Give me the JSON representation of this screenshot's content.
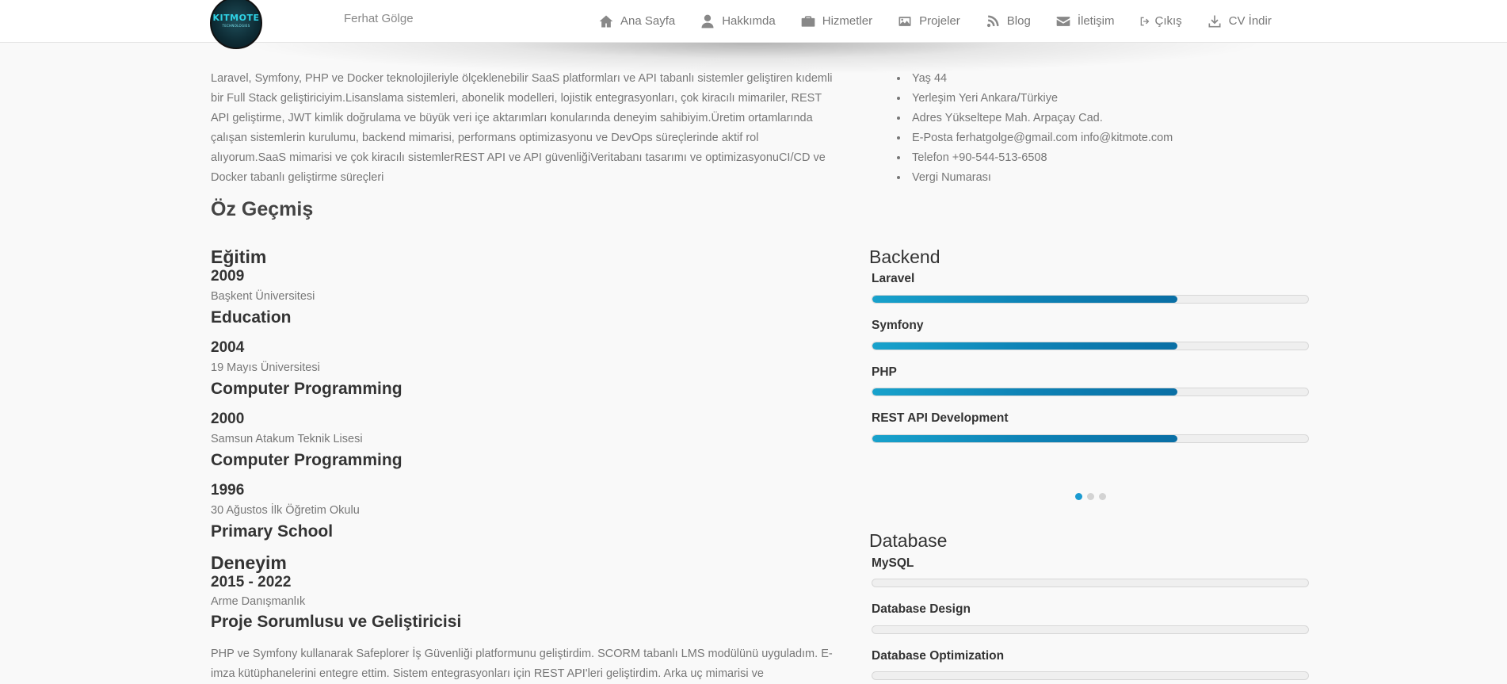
{
  "header": {
    "logo_text": "KITMOTE",
    "logo_subtext": "TECHNOLOGIES",
    "brand_name": "Ferhat Gölge",
    "nav": [
      {
        "label": "Ana Sayfa",
        "icon": "home-icon"
      },
      {
        "label": "Hakkımda",
        "icon": "user-icon"
      },
      {
        "label": "Hizmetler",
        "icon": "briefcase-icon"
      },
      {
        "label": "Projeler",
        "icon": "images-icon"
      },
      {
        "label": "Blog",
        "icon": "blog-icon"
      },
      {
        "label": "İletişim",
        "icon": "envelope-icon"
      },
      {
        "label": "Çıkış",
        "icon": "sign-out-icon"
      },
      {
        "label": "CV İndir",
        "icon": "download-icon"
      }
    ]
  },
  "intro": {
    "text": "Laravel, Symfony, PHP ve Docker teknolojileriyle ölçeklenebilir SaaS platformları ve API tabanlı sistemler geliştiren kıdemli bir Full Stack geliştiriciyim.Lisanslama sistemleri, abonelik modelleri, lojistik entegrasyonları, çok kiracılı mimariler, REST API geliştirme, JWT kimlik doğrulama ve büyük veri içe aktarımları konularında deneyim sahibiyim.Üretim ortamlarında çalışan sistemlerin kurulumu, backend mimarisi, performans optimizasyonu ve DevOps süreçlerinde aktif rol alıyorum.SaaS mimarisi ve çok kiracılı sistemlerREST API ve API güvenliğiVeritabanı tasarımı ve optimizasyonuCI/CD ve Docker tabanlı geliştirme süreçleri"
  },
  "info": [
    "Yaş 44",
    "Yerleşim Yeri Ankara/Türkiye",
    "Adres Yükseltepe Mah. Arpaçay Cad.",
    "E-Posta ferhatgolge@gmail.com info@kitmote.com",
    "Telefon +90-544-513-6508",
    "Vergi Numarası"
  ],
  "resume": {
    "title": "Öz Geçmiş",
    "education_title": "Eğitim",
    "education": [
      {
        "year": "2009",
        "school": "Başkent Üniversitesi",
        "degree": "Education"
      },
      {
        "year": "2004",
        "school": "19 Mayıs Üniversitesi",
        "degree": "Computer Programming"
      },
      {
        "year": "2000",
        "school": "Samsun Atakum Teknik Lisesi",
        "degree": "Computer Programming"
      },
      {
        "year": "1996",
        "school": "30 Ağustos İlk Öğretim Okulu",
        "degree": "Primary School"
      }
    ],
    "experience_title": "Deneyim",
    "experience": [
      {
        "years": "2015 - 2022",
        "company": "Arme Danışmanlık",
        "role": "Proje Sorumlusu ve Geliştiricisi",
        "description": "PHP ve Symfony kullanarak Safeplorer İş Güvenliği platformunu geliştirdim. SCORM tabanlı LMS modülünü uyguladım. E-imza kütüphanelerini entegre ettim. Sistem entegrasyonları için REST API'leri geliştirdim. Arka uç mimarisi ve"
      }
    ]
  },
  "skills": {
    "backend": {
      "title": "Backend",
      "items": [
        {
          "name": "Laravel",
          "level": 0.7
        },
        {
          "name": "Symfony",
          "level": 0.7
        },
        {
          "name": "PHP",
          "level": 0.7
        },
        {
          "name": "REST API Development",
          "level": 0.7
        }
      ]
    },
    "database": {
      "title": "Database",
      "items": [
        {
          "name": "MySQL",
          "level": 0
        },
        {
          "name": "Database Design",
          "level": 0
        },
        {
          "name": "Database Optimization",
          "level": 0
        }
      ]
    },
    "carousel": {
      "pages": 3,
      "active": 0
    }
  },
  "colors": {
    "accent": "#0e83b6",
    "accent_light": "#18a2cc",
    "dot_active": "#1b9bd1"
  }
}
